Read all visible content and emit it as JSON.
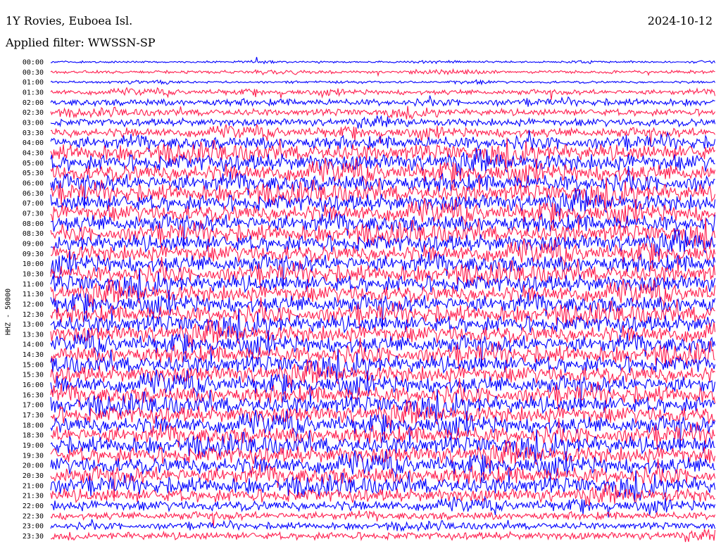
{
  "header": {
    "station": "1Y Rovies, Euboea Isl.",
    "date": "2024-10-12",
    "filter": "Applied filter: WWSSN-SP"
  },
  "chart_data": {
    "type": "line",
    "ylabel": "HHZ - 50000",
    "rows": [
      "00:00",
      "00:30",
      "01:00",
      "01:30",
      "02:00",
      "02:30",
      "03:00",
      "03:30",
      "04:00",
      "04:30",
      "05:00",
      "05:30",
      "06:00",
      "06:30",
      "07:00",
      "07:30",
      "08:00",
      "08:30",
      "09:00",
      "09:30",
      "10:00",
      "10:30",
      "11:00",
      "11:30",
      "12:00",
      "12:30",
      "13:00",
      "13:30",
      "14:00",
      "14:30",
      "15:00",
      "15:30",
      "16:00",
      "16:30",
      "17:00",
      "17:30",
      "18:00",
      "18:30",
      "19:00",
      "19:30",
      "20:00",
      "20:30",
      "21:00",
      "21:30",
      "22:00",
      "22:30",
      "23:00",
      "23:30"
    ],
    "amplitude_relative": [
      0.12,
      0.18,
      0.15,
      0.3,
      0.4,
      0.4,
      0.45,
      0.55,
      0.75,
      0.95,
      1.0,
      1.0,
      1.0,
      1.0,
      1.0,
      1.0,
      1.0,
      1.0,
      1.0,
      1.0,
      1.0,
      1.0,
      1.0,
      1.0,
      1.0,
      1.0,
      1.0,
      1.0,
      1.0,
      1.0,
      1.0,
      1.0,
      1.0,
      1.0,
      1.0,
      1.0,
      1.0,
      1.0,
      1.0,
      1.0,
      1.0,
      1.0,
      0.95,
      0.8,
      0.6,
      0.45,
      0.4,
      0.45
    ],
    "colors": {
      "even_rows": "#0000ff",
      "odd_rows": "#ff1e4e"
    }
  }
}
